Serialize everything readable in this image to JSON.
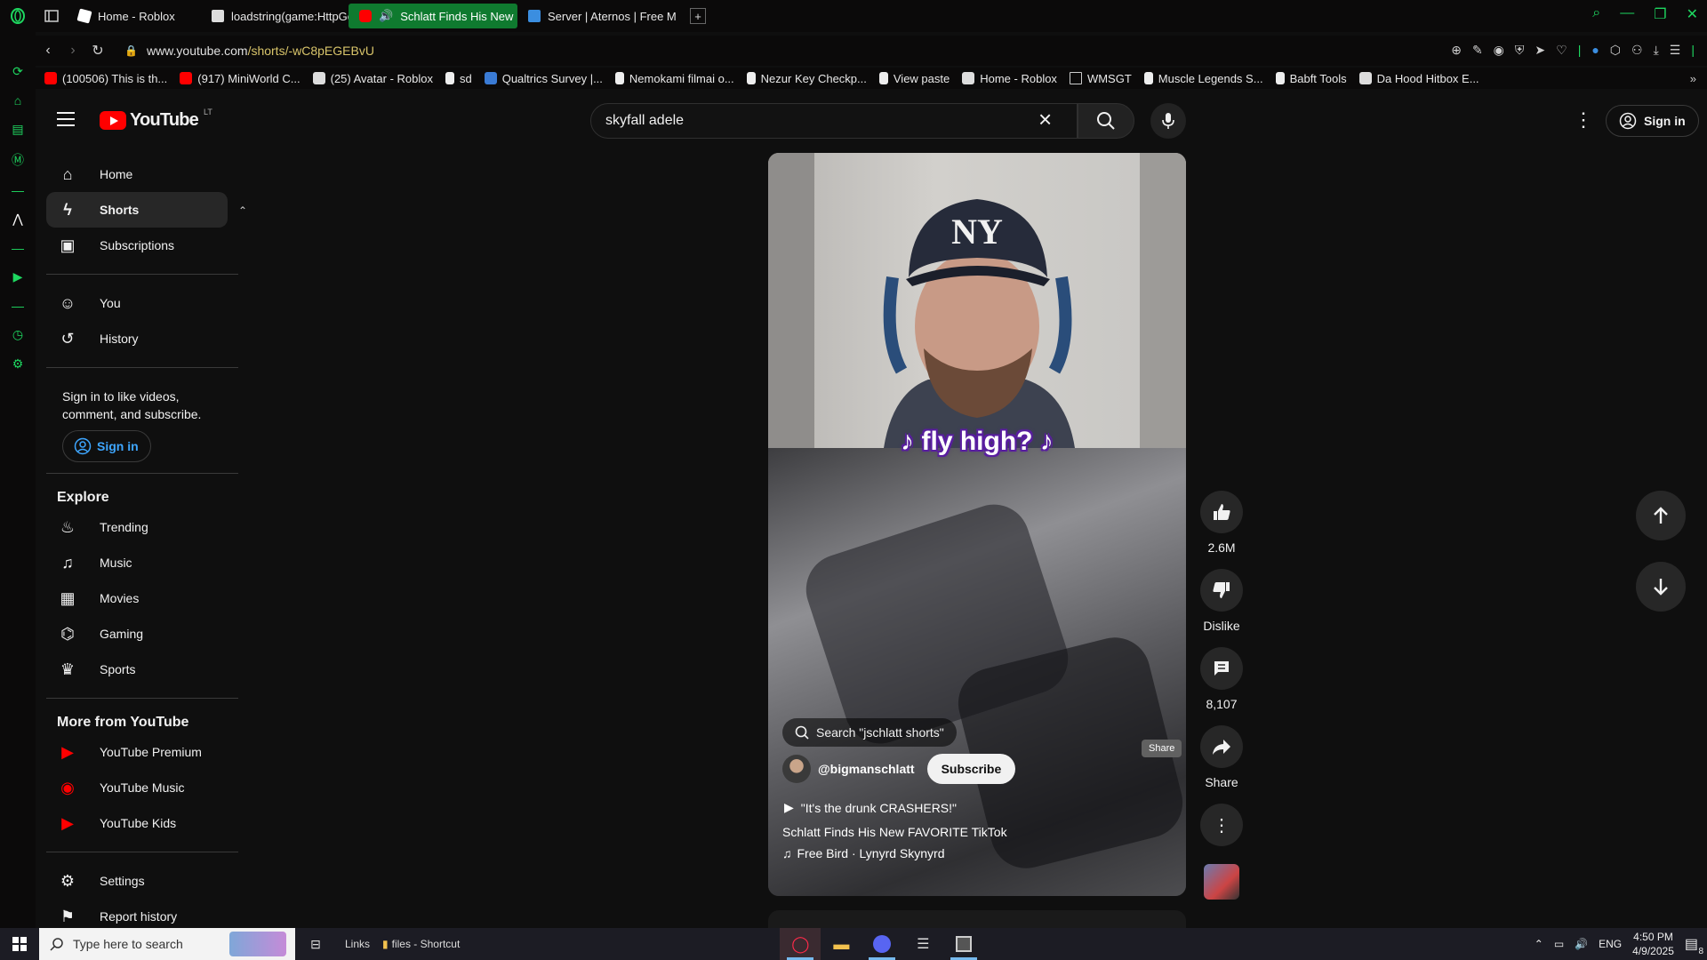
{
  "browser": {
    "tabs": [
      {
        "label": "Home - Roblox",
        "color": "#ffffff"
      },
      {
        "label": "loadstring(game:HttpGet(",
        "color": "#dddddd"
      },
      {
        "label": "Schlatt Finds His New",
        "color": "#ff0000",
        "active": true
      },
      {
        "label": "Server | Aternos | Free M",
        "color": "#3b8ee0"
      }
    ],
    "url_host": "www.youtube.com",
    "url_path": "/shorts/-wC8pEGEBvU",
    "accent": "#1ed760",
    "bookmarks": [
      {
        "label": "(100506) This is th...",
        "color": "#ff0000"
      },
      {
        "label": "(917) MiniWorld C...",
        "color": "#ff0000"
      },
      {
        "label": "(25) Avatar - Roblox",
        "color": "#dddddd"
      },
      {
        "label": "sd",
        "color": "#eeeeee"
      },
      {
        "label": "Qualtrics Survey |...",
        "color": "#3a7bd5"
      },
      {
        "label": "Nemokami filmai o...",
        "color": "#eeeeee"
      },
      {
        "label": "Nezur Key Checkp...",
        "color": "#eeeeee"
      },
      {
        "label": "View paste",
        "color": "#eeeeee"
      },
      {
        "label": "Home - Roblox",
        "color": "#dddddd"
      },
      {
        "label": "WMSGT",
        "color": "#cccccc"
      },
      {
        "label": "Muscle Legends S...",
        "color": "#eeeeee"
      },
      {
        "label": "Babft Tools",
        "color": "#eeeeee"
      },
      {
        "label": "Da Hood Hitbox E...",
        "color": "#dddddd"
      }
    ]
  },
  "youtube": {
    "logo_text": "YouTube",
    "country_code": "LT",
    "search_value": "skyfall adele",
    "signin_label": "Sign in",
    "guide": {
      "main": [
        {
          "label": "Home",
          "icon": "home-icon"
        },
        {
          "label": "Shorts",
          "icon": "shorts-icon",
          "active": true
        },
        {
          "label": "Subscriptions",
          "icon": "subscriptions-icon"
        }
      ],
      "you": [
        {
          "label": "You",
          "icon": "you-icon"
        },
        {
          "label": "History",
          "icon": "history-icon"
        }
      ],
      "signin_prompt": "Sign in to like videos, comment, and subscribe.",
      "signin_button": "Sign in",
      "explore_title": "Explore",
      "explore": [
        {
          "label": "Trending",
          "icon": "trending-icon"
        },
        {
          "label": "Music",
          "icon": "music-icon"
        },
        {
          "label": "Movies",
          "icon": "movies-icon"
        },
        {
          "label": "Gaming",
          "icon": "gaming-icon"
        },
        {
          "label": "Sports",
          "icon": "sports-icon"
        }
      ],
      "more_title": "More from YouTube",
      "more": [
        {
          "label": "YouTube Premium",
          "icon": "youtube-premium-icon"
        },
        {
          "label": "YouTube Music",
          "icon": "youtube-music-icon"
        },
        {
          "label": "YouTube Kids",
          "icon": "youtube-kids-icon"
        }
      ],
      "settings": [
        {
          "label": "Settings",
          "icon": "settings-icon"
        },
        {
          "label": "Report history",
          "icon": "report-icon"
        }
      ]
    },
    "short": {
      "lyric": "♪ fly high? ♪",
      "search_suggestion": "Search \"jschlatt shorts\"",
      "channel": "@bigmanschlatt",
      "subscribe": "Subscribe",
      "quote": "\"It's the drunk CRASHERS!\"",
      "title": "Schlatt Finds His New FAVORITE TikTok",
      "music": "Free Bird · Lynyrd Skynyrd"
    },
    "actions": {
      "likes": "2.6M",
      "dislike": "Dislike",
      "comments": "8,107",
      "share": "Share",
      "share_tooltip": "Share"
    }
  },
  "taskbar": {
    "search_placeholder": "Type here to search",
    "links_label": "Links",
    "folder_label": "files - Shortcut",
    "lang": "ENG",
    "time": "4:50 PM",
    "date": "4/9/2025",
    "notif_count": "8"
  }
}
